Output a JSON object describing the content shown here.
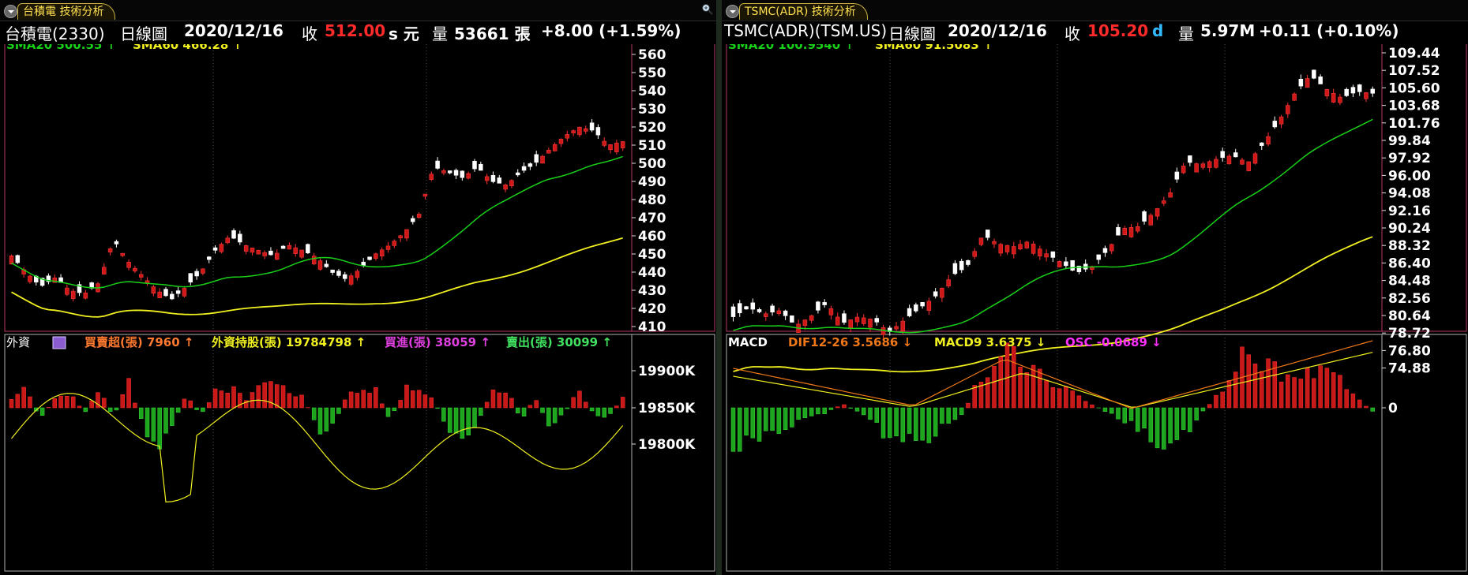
{
  "left": {
    "tab_label": "台積電 技術分析",
    "header": {
      "name": "台積電(2330)",
      "period": "日線圖",
      "date": "2020/12/16",
      "close_label": "收",
      "close": "512.00",
      "close_suffix": "s 元",
      "vol_label": "量",
      "volume": "53661 張",
      "change": "+8.00 (+1.59%)"
    },
    "price_legend": {
      "sma20": "SMA20 500.55",
      "sma60": "SMA60 466.28"
    },
    "y_labels": [
      "560",
      "550",
      "540",
      "530",
      "520",
      "510",
      "500",
      "490",
      "480",
      "470",
      "460",
      "450",
      "440",
      "430",
      "420",
      "410"
    ],
    "sub_legend": {
      "title": "外資",
      "net": "買賣超(張) 7960",
      "holding": "外資持股(張) 19784798",
      "buy": "買進(張) 38059",
      "sell": "賣出(張) 30099"
    },
    "sub_y_labels": [
      "19900K",
      "19850K",
      "19800K"
    ],
    "colors": {
      "sma20": "#18d018",
      "sma60": "#f0f020",
      "up": "#d01818",
      "down": "#ffffff",
      "bar_up": "#c81818",
      "bar_down": "#1ea51e"
    }
  },
  "right": {
    "tab_label": "TSMC(ADR) 技術分析",
    "header": {
      "name": "TSMC(ADR)(TSM.US)",
      "period": "日線圖",
      "date": "2020/12/16",
      "close_label": "收",
      "close": "105.20",
      "close_suffix": "d",
      "vol_label": "量",
      "volume": "5.97M",
      "change": "+0.11 (+0.10%)"
    },
    "price_legend": {
      "sma20": "SMA20 100.9540",
      "sma60": "SMA60 91.5083"
    },
    "y_labels": [
      "109.44",
      "107.52",
      "105.60",
      "103.68",
      "101.76",
      "99.84",
      "97.92",
      "96.00",
      "94.08",
      "92.16",
      "90.24",
      "88.32",
      "86.40",
      "84.48",
      "82.56",
      "80.64",
      "78.72",
      "76.80",
      "74.88"
    ],
    "sub_legend": {
      "title": "MACD",
      "dif": "DIF12-26 3.5686",
      "macd9": "MACD9 3.6375",
      "osc": "OSC -0.0689"
    },
    "sub_y_labels": [
      "0"
    ],
    "colors": {
      "dif": "#f07818",
      "macd9": "#f0f020",
      "osc": "#ff30ff"
    }
  }
}
